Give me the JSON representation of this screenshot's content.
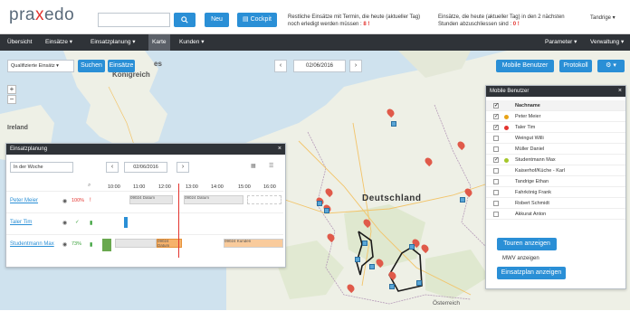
{
  "header": {
    "logo": {
      "pre": "pra",
      "x": "x",
      "post": "edo"
    },
    "search_placeholder": "",
    "search_button_icon": "search-icon",
    "new_label": "Neu",
    "cockpit_label": "Cockpit",
    "notif1": {
      "text": "Restliche Einsätze mit Termin, die heute (aktueller Tag) noch erledigt werden müssen :",
      "count": "8"
    },
    "notif2": {
      "text": "Einsätze, die heute (aktueller Tag) in den 2 nächsten Stunden abzuschliessen sind :",
      "count": "0"
    },
    "user_menu": "Tandrige ▾"
  },
  "nav": {
    "items": [
      {
        "label": "Übersicht"
      },
      {
        "label": "Einsätze ▾"
      },
      {
        "label": "Einsatzplanung ▾"
      },
      {
        "label": "Karte"
      },
      {
        "label": "Kunden ▾"
      }
    ],
    "right_items": [
      {
        "label": "Parameter ▾"
      },
      {
        "label": "Verwaltung ▾"
      }
    ]
  },
  "map_toolbar": {
    "filter_select": "Qualifizierte Einsätz ▾",
    "search_label": "Suchen",
    "insert_label": "Einsätze",
    "date": "02/06/2016",
    "mobile_users_label": "Mobile Benutzer",
    "protocol_label": "Protokoll",
    "settings_label": "⚙ ▾"
  },
  "map": {
    "country_label": "Deutschland",
    "labels": [
      {
        "text": "Ireland"
      },
      {
        "text": "Königreich"
      },
      {
        "text": "es"
      },
      {
        "text": "Österreich"
      }
    ],
    "zoom_in": "+",
    "zoom_out": "−"
  },
  "deployment": {
    "title": "Einsatzplanung",
    "range_select": "In der Woche",
    "date": "02/06/2016",
    "hours": [
      "10:00",
      "11:00",
      "12:00",
      "13:00",
      "14:00",
      "15:00",
      "16:00"
    ],
    "workers": [
      {
        "name": "Peter Meier",
        "pct": "100%",
        "pct_color": "#e3342f"
      },
      {
        "name": "Taler Tim",
        "pct": "✓",
        "pct_color": "#3aa13a"
      },
      {
        "name": "Studentmann Max",
        "pct": "73%",
        "pct_color": "#3aa13a"
      }
    ],
    "bars": [
      {
        "text": "09024 Datum"
      },
      {
        "text": "09024 Datum"
      },
      {
        "text": "09024 Datum"
      },
      {
        "text": "09024 Kunden"
      }
    ]
  },
  "mobile_users": {
    "title": "Mobile Benutzer",
    "header": "Nachname",
    "rows": [
      {
        "name": "Peter Meier",
        "checked": true,
        "dot": "#e8a317"
      },
      {
        "name": "Taler Tim",
        "checked": true,
        "dot": "#e3342f"
      },
      {
        "name": "Weingut Willi",
        "checked": false,
        "dot": ""
      },
      {
        "name": "Müller Daniel",
        "checked": false,
        "dot": ""
      },
      {
        "name": "Studentmann Max",
        "checked": true,
        "dot": "#a5c72b"
      },
      {
        "name": "Kaiserhof/Küche - Karl",
        "checked": false,
        "dot": ""
      },
      {
        "name": "Tandrige Ethan",
        "checked": false,
        "dot": ""
      },
      {
        "name": "Fahrkönig Frank",
        "checked": false,
        "dot": ""
      },
      {
        "name": "Robert Schmidt",
        "checked": false,
        "dot": ""
      },
      {
        "name": "Akkurat Anton",
        "checked": false,
        "dot": ""
      }
    ],
    "show_tours": "Touren anzeigen",
    "mwv_link": "MWV anzeigen",
    "show_plan": "Einsatzplan anzeigen"
  },
  "colors": {
    "accent": "#2a8fd6",
    "nav_bg": "#2f3338",
    "map_water": "#cfe2ee",
    "map_land": "#eef0e6",
    "pin": "#e05a4a",
    "route": "#1a1a1a"
  }
}
